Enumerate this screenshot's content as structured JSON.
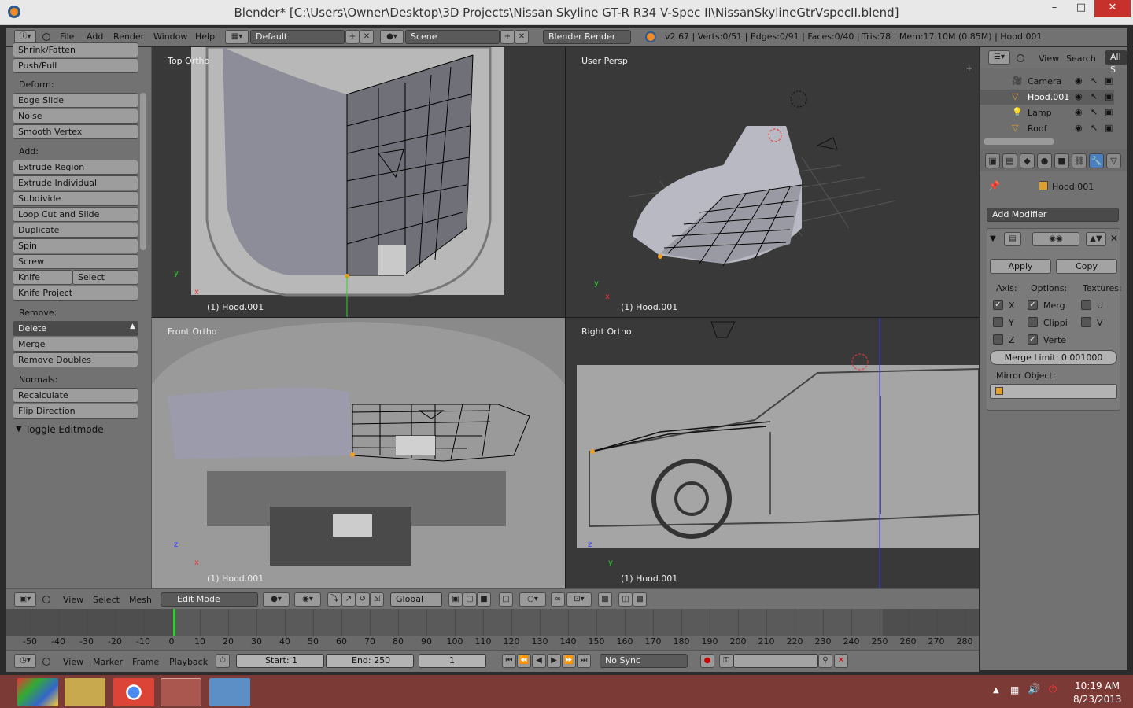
{
  "window": {
    "title": "Blender* [C:\\Users\\Owner\\Desktop\\3D Projects\\Nissan Skyline GT-R R34 V-Spec II\\NissanSkylineGtrVspecII.blend]",
    "minimize": "–",
    "maximize": "□",
    "close": "✕"
  },
  "infobar": {
    "menus": [
      "File",
      "Add",
      "Render",
      "Window",
      "Help"
    ],
    "screen_layout": "Default",
    "scene": "Scene",
    "render_engine": "Blender Render",
    "stats": "v2.67 | Verts:0/51 | Edges:0/91 | Faces:0/40 | Tris:78 | Mem:17.10M (0.85M) | Hood.001"
  },
  "toolshelf": {
    "top_items": [
      "Shrink/Fatten",
      "Push/Pull"
    ],
    "deform_label": "Deform:",
    "deform": [
      "Edge Slide",
      "Noise",
      "Smooth Vertex"
    ],
    "add_label": "Add:",
    "add": [
      "Extrude Region",
      "Extrude Individual",
      "Subdivide",
      "Loop Cut and Slide",
      "Duplicate",
      "Spin",
      "Screw"
    ],
    "knife": "Knife",
    "select": "Select",
    "knife_project": "Knife Project",
    "remove_label": "Remove:",
    "delete": "Delete",
    "remove": [
      "Merge",
      "Remove Doubles"
    ],
    "normals_label": "Normals:",
    "normals": [
      "Recalculate",
      "Flip Direction"
    ],
    "toggle_editmode": "Toggle Editmode"
  },
  "viewports": {
    "top": {
      "name": "Top Ortho",
      "object": "(1) Hood.001",
      "axis1": "y",
      "axis2": "x"
    },
    "persp": {
      "name": "User Persp",
      "object": "(1) Hood.001",
      "axis1": "y",
      "axis2": "x"
    },
    "front": {
      "name": "Front Ortho",
      "object": "(1) Hood.001",
      "axis1": "z",
      "axis2": "x"
    },
    "right": {
      "name": "Right Ortho",
      "object": "(1) Hood.001",
      "axis1": "z",
      "axis2": "y"
    }
  },
  "view3d_header": {
    "menus": [
      "View",
      "Select",
      "Mesh"
    ],
    "mode": "Edit Mode",
    "orientation": "Global"
  },
  "timeline": {
    "ticks": [
      "-50",
      "-40",
      "-30",
      "-20",
      "-10",
      "0",
      "10",
      "20",
      "30",
      "40",
      "50",
      "60",
      "70",
      "80",
      "90",
      "100",
      "110",
      "120",
      "130",
      "140",
      "150",
      "160",
      "170",
      "180",
      "190",
      "200",
      "210",
      "220",
      "230",
      "240",
      "250",
      "260",
      "270",
      "280"
    ],
    "menus": [
      "View",
      "Marker",
      "Frame",
      "Playback"
    ],
    "start": "Start: 1",
    "end": "End: 250",
    "current": "1",
    "sync": "No Sync"
  },
  "outliner": {
    "menus": [
      "View",
      "Search"
    ],
    "filter": "All S",
    "items": [
      {
        "name": "Camera",
        "icon": "camera-icon"
      },
      {
        "name": "Hood.001",
        "icon": "mesh-icon"
      },
      {
        "name": "Lamp",
        "icon": "lamp-icon"
      },
      {
        "name": "Roof",
        "icon": "mesh-icon"
      }
    ]
  },
  "properties": {
    "object": "Hood.001",
    "add_modifier": "Add Modifier",
    "apply": "Apply",
    "copy": "Copy",
    "axis_label": "Axis:",
    "options_label": "Options:",
    "textures_label": "Textures:",
    "axis_x": "X",
    "axis_y": "Y",
    "axis_z": "Z",
    "opt_merge": "Merg",
    "opt_clip": "Clippi",
    "opt_vert": "Verte",
    "tex_u": "U",
    "tex_v": "V",
    "merge_limit": "Merge Limit: 0.001000",
    "mirror_object_label": "Mirror Object:"
  },
  "taskbar": {
    "time": "10:19 AM",
    "date": "8/23/2013"
  },
  "colors": {
    "panel": "#727272",
    "viewport": "#393939",
    "button": "#9d9d9d",
    "taskbar": "#7b3a35",
    "frame_marker": "#2ad12a"
  }
}
